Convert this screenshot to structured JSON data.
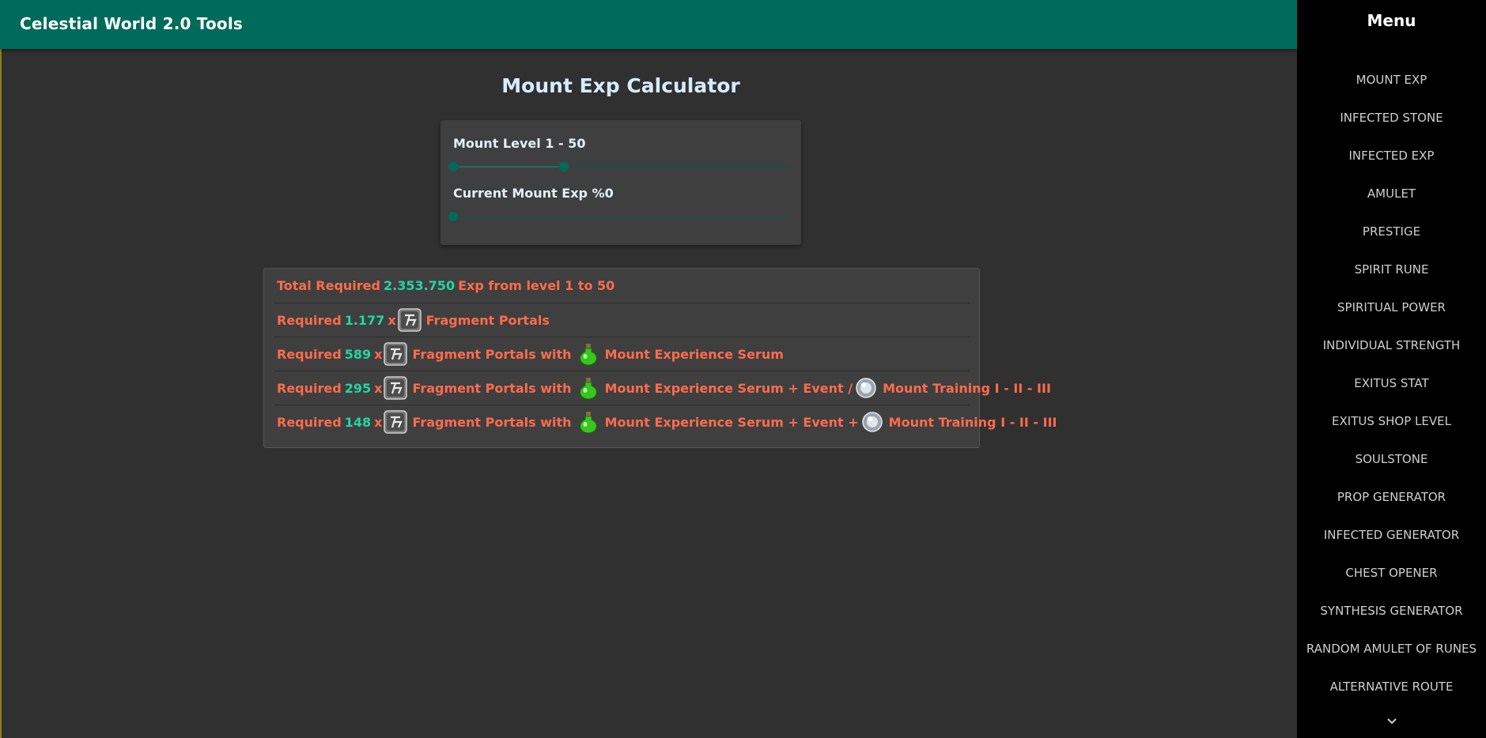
{
  "app": {
    "title": "Celestial World 2.0 Tools"
  },
  "menu": {
    "title": "Menu",
    "items": [
      "MOUNT EXP",
      "INFECTED STONE",
      "INFECTED EXP",
      "AMULET",
      "PRESTIGE",
      "SPIRIT RUNE",
      "SPIRITUAL POWER",
      "INDIVIDUAL STRENGTH",
      "EXITUS STAT",
      "EXITUS SHOP LEVEL",
      "SOULSTONE",
      "PROP GENERATOR",
      "INFECTED GENERATOR",
      "CHEST OPENER",
      "SYNTHESIS GENERATOR",
      "RANDOM AMULET OF RUNES",
      "ALTERNATIVE ROUTE"
    ],
    "more_icon": "chevron-down-icon"
  },
  "page": {
    "title": "Mount Exp Calculator"
  },
  "calculator": {
    "level_label": "Mount Level 1 - 50",
    "level_range": {
      "min": 1,
      "max": 50,
      "low_fraction": 0.0,
      "high_fraction": 0.33
    },
    "exp_label": "Current Mount Exp %0",
    "exp_value": 0
  },
  "results": {
    "total": {
      "prefix": "Total Required",
      "value": "2.353.750",
      "suffix": "Exp from level 1 to 50"
    },
    "rows": [
      {
        "prefix": "Required",
        "count": "1.177",
        "x": "x",
        "portal": "Fragment Portals"
      },
      {
        "prefix": "Required",
        "count": "589",
        "x": "x",
        "portal": "Fragment Portals with",
        "serum": "Mount Experience Serum"
      },
      {
        "prefix": "Required",
        "count": "295",
        "x": "x",
        "portal": "Fragment Portals with",
        "serum": "Mount Experience Serum + Event /",
        "training": "Mount Training I - II - III"
      },
      {
        "prefix": "Required",
        "count": "148",
        "x": "x",
        "portal": "Fragment Portals with",
        "serum": "Mount Experience Serum + Event +",
        "training": "Mount Training I - II - III"
      }
    ]
  },
  "colors": {
    "header": "#006b5a",
    "background": "#303030",
    "card": "#3f3f3f",
    "sidebar": "#000000",
    "result_text": "#ff6b4d",
    "result_number": "#22d6a2"
  }
}
